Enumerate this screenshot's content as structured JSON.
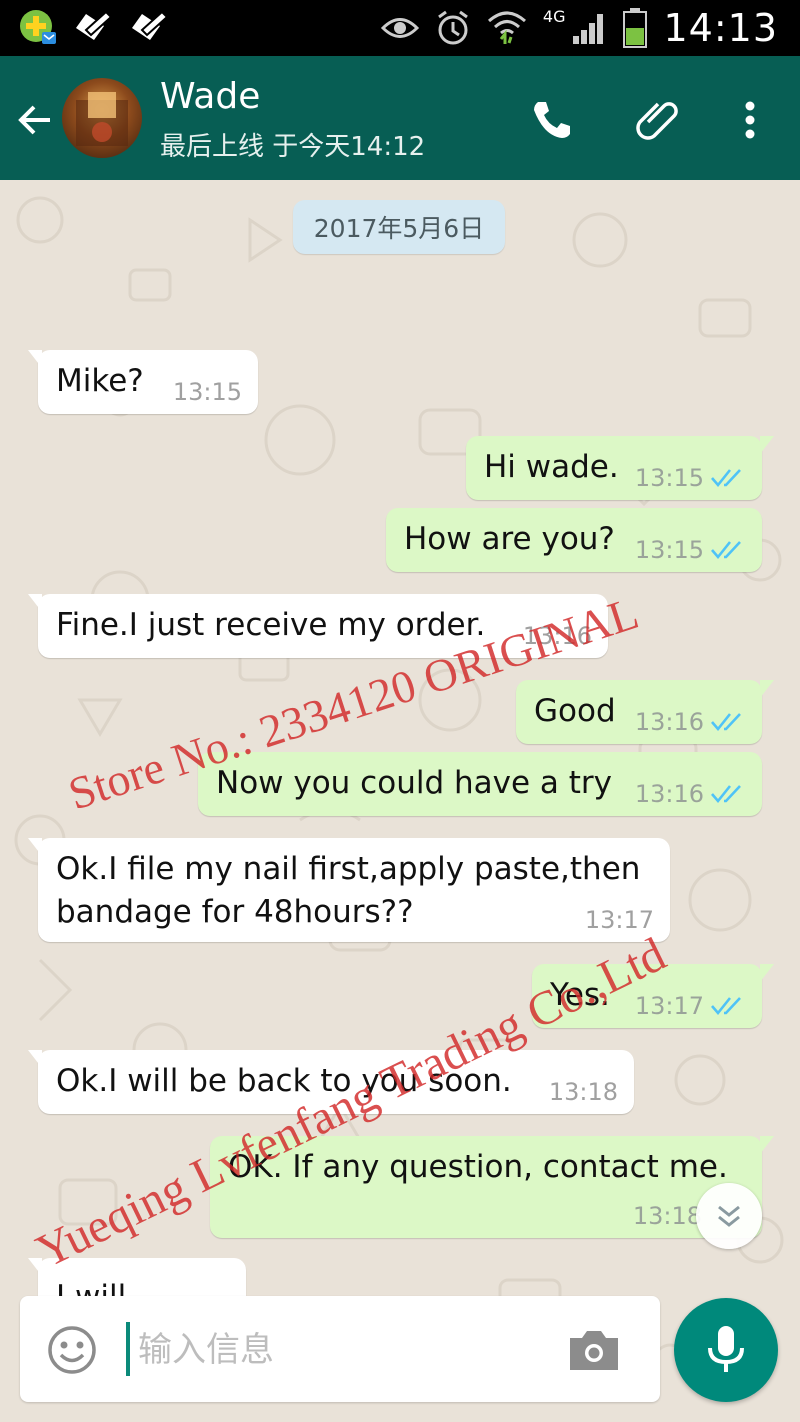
{
  "status_bar": {
    "time": "14:13",
    "network": "4G",
    "icons": [
      "app-store-icon",
      "notification-icon",
      "notification-icon",
      "eye-icon",
      "alarm-icon",
      "wifi-icon",
      "signal-icon",
      "battery-icon"
    ]
  },
  "header": {
    "contact_name": "Wade",
    "last_seen": "最后上线 于今天14:12",
    "icons": [
      "back-arrow-icon",
      "phone-icon",
      "paperclip-icon",
      "more-vert-icon"
    ],
    "color": "#075e54"
  },
  "chat": {
    "date_chip": "2017年5月6日",
    "messages": [
      {
        "dir": "in",
        "text": "Mike?",
        "time": "13:15"
      },
      {
        "dir": "out",
        "text": "Hi wade.",
        "time": "13:15",
        "status": "read"
      },
      {
        "dir": "out",
        "text": "How are you?",
        "time": "13:15",
        "status": "read"
      },
      {
        "dir": "in",
        "text": "Fine.I just receive my order.",
        "time": "13:16"
      },
      {
        "dir": "out",
        "text": "Good",
        "time": "13:16",
        "status": "read"
      },
      {
        "dir": "out",
        "text": "Now you could have a try",
        "time": "13:16",
        "status": "read"
      },
      {
        "dir": "in",
        "text": "Ok.I file my nail first,apply paste,then\nbandage for 48hours??",
        "time": "13:17"
      },
      {
        "dir": "out",
        "text": "Yes.",
        "time": "13:17",
        "status": "read"
      },
      {
        "dir": "in",
        "text": "Ok.I will be back to you soon.",
        "time": "13:18"
      },
      {
        "dir": "out",
        "text": "OK. If any question, contact me.",
        "time": "13:18"
      },
      {
        "dir": "in",
        "text": "I will",
        "time": ""
      }
    ],
    "incoming_color": "#ffffff",
    "outgoing_color": "#dcf8c6",
    "read_tick_color": "#4fc3f7"
  },
  "input": {
    "placeholder": "输入信息",
    "icons": [
      "emoji-icon",
      "camera-icon",
      "mic-icon"
    ],
    "mic_color": "#00897b"
  },
  "watermarks": {
    "line1": "Store No.: 2334120 ORIGINAL",
    "line2": "Yueqing Lvfenfang Trading Co.,Ltd"
  }
}
